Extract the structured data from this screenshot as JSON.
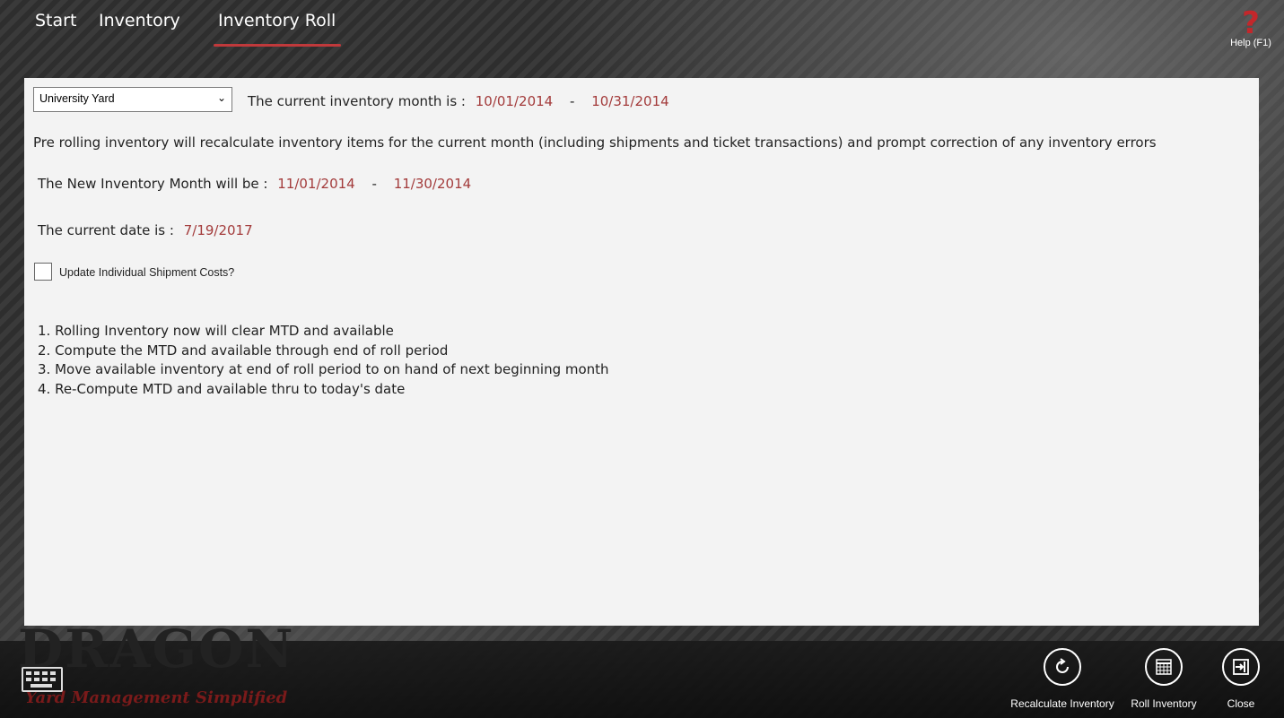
{
  "nav": {
    "tabs": [
      {
        "label": "Start"
      },
      {
        "label": "Inventory"
      },
      {
        "label": "Inventory Roll",
        "active": true
      }
    ],
    "help_label": "Help (F1)",
    "help_glyph": "?"
  },
  "location_select": {
    "value": "University Yard"
  },
  "current_month": {
    "label": "The current inventory month is :",
    "start": "10/01/2014",
    "sep": "-",
    "end": "10/31/2014"
  },
  "description": "Pre rolling inventory will recalculate inventory items for the current month (including shipments and ticket transactions) and prompt correction of any inventory errors",
  "new_month": {
    "label": "The New Inventory Month will be :",
    "start": "11/01/2014",
    "sep": "-",
    "end": "11/30/2014"
  },
  "current_date": {
    "label": "The current date is :",
    "value": "7/19/2017"
  },
  "update_costs": {
    "label": "Update Individual Shipment Costs?",
    "checked": false
  },
  "steps": [
    "1. Rolling Inventory now will clear MTD and available",
    "2. Compute the MTD and available through end of roll period",
    "3. Move available inventory at end of roll period to on hand of next beginning month",
    "4. Re-Compute MTD and available thru to today's date"
  ],
  "branding": {
    "logo": "DRAGON",
    "tagline": "Yard Management Simplified"
  },
  "appbar": {
    "buttons": [
      {
        "label": "Recalculate Inventory",
        "icon": "refresh-icon"
      },
      {
        "label": "Roll Inventory",
        "icon": "calendar-icon"
      },
      {
        "label": "Close",
        "icon": "exit-icon"
      }
    ]
  },
  "colors": {
    "accent": "#c0393b",
    "date_text": "#a33b3b",
    "panel_bg": "#f3f3f3"
  }
}
